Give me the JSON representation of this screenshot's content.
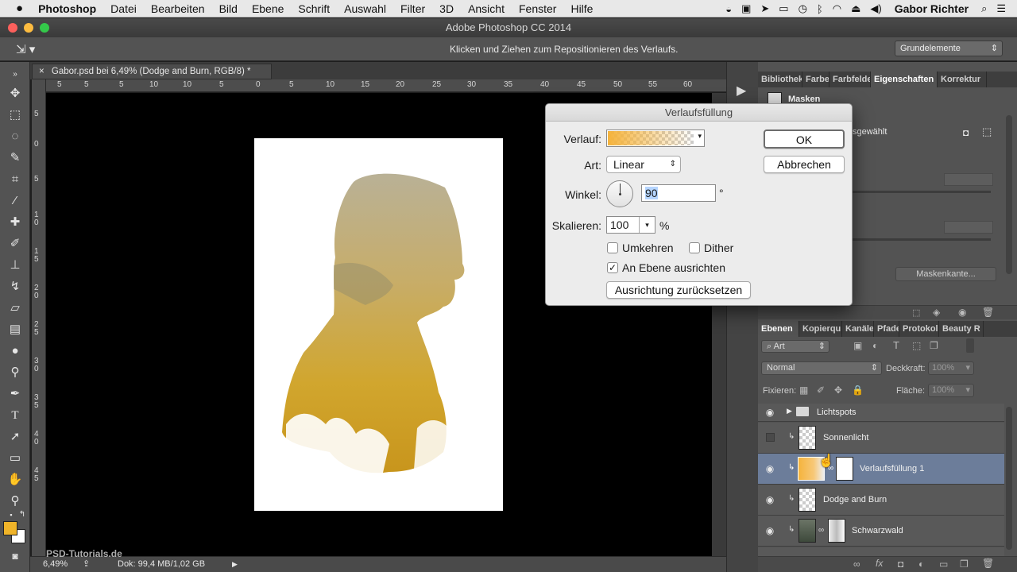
{
  "menubar": {
    "apple": "",
    "app": "Photoshop",
    "items": [
      "Datei",
      "Bearbeiten",
      "Bild",
      "Ebene",
      "Schrift",
      "Auswahl",
      "Filter",
      "3D",
      "Ansicht",
      "Fenster",
      "Hilfe"
    ],
    "user": "Gabor Richter"
  },
  "window": {
    "title": "Adobe Photoshop CC 2014"
  },
  "options": {
    "hint": "Klicken und Ziehen zum Repositionieren des Verlaufs.",
    "workspace": "Grundelemente"
  },
  "document": {
    "tab": "Gabor.psd bei 6,49% (Dodge and Burn, RGB/8) *",
    "ruler_h": [
      "5",
      "0",
      "5",
      "10",
      "15",
      "20",
      "25",
      "30",
      "35",
      "40",
      "45",
      "50",
      "55",
      "60"
    ],
    "ruler_v": [
      "0",
      "5",
      "0",
      "5",
      "1 0",
      "1 5",
      "2 0",
      "2 5",
      "3 0",
      "3 5",
      "4 0",
      "4 5"
    ]
  },
  "status": {
    "zoom": "6,49%",
    "doc": "Dok: 99,4 MB/1,02 GB"
  },
  "panels": {
    "top_tabs": [
      "Bibliothek",
      "Farbe",
      "Farbfelder",
      "Eigenschaften",
      "Korrektur"
    ],
    "properties": {
      "title": "Masken",
      "selected_text": "sgewählt",
      "mask_edge_button": "Maskenkante..."
    },
    "layer_tabs": [
      "Ebenen",
      "Kopierqu",
      "Kanäle",
      "Pfade",
      "Protokoll",
      "Beauty R"
    ],
    "filter": "Art",
    "blend_mode": "Normal",
    "opacity_label": "Deckkraft:",
    "opacity_value": "100%",
    "lock_label": "Fixieren:",
    "fill_label": "Fläche:",
    "fill_value": "100%",
    "layers": [
      {
        "name": "Lichtspots",
        "type": "group",
        "visible": true,
        "selected": false
      },
      {
        "name": "Sonnenlicht",
        "type": "pixel",
        "visible": false,
        "selected": false
      },
      {
        "name": "Verlaufsfüllung 1",
        "type": "gradient-fill",
        "visible": true,
        "selected": true
      },
      {
        "name": "Dodge and Burn",
        "type": "pixel",
        "visible": true,
        "selected": false
      },
      {
        "name": "Schwarzwald",
        "type": "smart-masked",
        "visible": true,
        "selected": false
      }
    ]
  },
  "dialog": {
    "title": "Verlaufsfüllung",
    "gradient_label": "Verlauf:",
    "style_label": "Art:",
    "style_value": "Linear",
    "angle_label": "Winkel:",
    "angle_value": "90",
    "angle_unit": "°",
    "scale_label": "Skalieren:",
    "scale_value": "100",
    "scale_unit": "%",
    "reverse_label": "Umkehren",
    "reverse_checked": false,
    "dither_label": "Dither",
    "dither_checked": false,
    "align_label": "An Ebene ausrichten",
    "align_checked": true,
    "reset_button": "Ausrichtung zurücksetzen",
    "ok_button": "OK",
    "cancel_button": "Abbrechen"
  },
  "watermark": "PSD-Tutorials.de",
  "colors": {
    "foreground": "#f0b429",
    "background": "#ffffff",
    "gradient_start": "#f5b33c",
    "selection": "#6c7d9a"
  }
}
